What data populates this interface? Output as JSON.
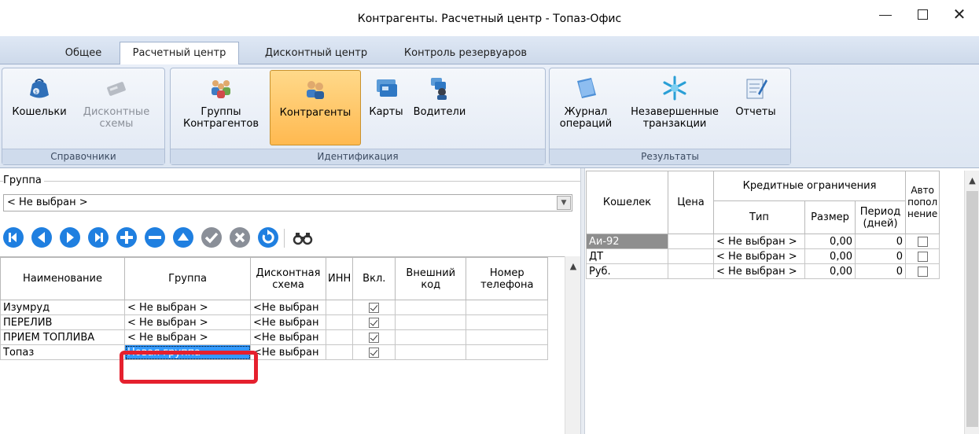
{
  "window": {
    "title": "Контрагенты. Расчетный центр - Топаз-Офис",
    "minimize": "–",
    "maximize": "☐",
    "close": "✕"
  },
  "tabs": [
    {
      "label": "Общее",
      "active": false
    },
    {
      "label": "Расчетный центр",
      "active": true
    },
    {
      "label": "Дисконтный центр",
      "active": false
    },
    {
      "label": "Контроль резервуаров",
      "active": false
    }
  ],
  "ribbon": {
    "groups": [
      {
        "label": "Справочники",
        "buttons": [
          {
            "label": "Кошельки",
            "icon": "wallet-bag-icon",
            "state": "normal"
          },
          {
            "label": "Дисконтные схемы",
            "icon": "discount-scheme-icon",
            "state": "disabled"
          }
        ]
      },
      {
        "label": "Идентификация",
        "buttons": [
          {
            "label": "Группы Контрагентов",
            "icon": "contractor-groups-icon",
            "state": "normal"
          },
          {
            "label": "Контрагенты",
            "icon": "contractors-icon",
            "state": "active"
          },
          {
            "label": "Карты",
            "icon": "cards-icon",
            "state": "normal"
          },
          {
            "label": "Водители",
            "icon": "drivers-icon",
            "state": "normal"
          }
        ]
      },
      {
        "label": "Результаты",
        "buttons": [
          {
            "label": "Журнал операций",
            "icon": "operations-journal-icon",
            "state": "normal"
          },
          {
            "label": "Незавершенные транзакции",
            "icon": "unfinished-transactions-icon",
            "state": "normal"
          },
          {
            "label": "Отчеты",
            "icon": "reports-icon",
            "state": "normal"
          }
        ]
      }
    ]
  },
  "group_filter": {
    "legend": "Группа",
    "value": "< Не выбран >"
  },
  "navigator": [
    "first-icon",
    "prev-icon",
    "next-icon",
    "last-icon",
    "add-icon",
    "delete-icon",
    "up-icon",
    "confirm-icon",
    "cancel-icon",
    "refresh-icon",
    "binoculars-icon"
  ],
  "contractors_table": {
    "headers": [
      "Наименование",
      "Группа",
      "Дисконтная схема",
      "ИНН",
      "Вкл.",
      "Внешний код",
      "Номер телефона"
    ],
    "rows": [
      {
        "name": "Изумруд",
        "group": "< Не выбран >",
        "scheme": "<Не выбран",
        "inn": "",
        "enabled": true,
        "ext": "",
        "phone": ""
      },
      {
        "name": "ПЕРЕЛИВ",
        "group": "< Не выбран >",
        "scheme": "<Не выбран",
        "inn": "",
        "enabled": true,
        "ext": "",
        "phone": ""
      },
      {
        "name": "ПРИЕМ ТОПЛИВА",
        "group": "< Не выбран >",
        "scheme": "<Не выбран",
        "inn": "",
        "enabled": true,
        "ext": "",
        "phone": ""
      },
      {
        "name": "Топаз",
        "group": "Новая группа",
        "scheme": "<Не выбран",
        "inn": "",
        "enabled": true,
        "ext": "",
        "phone": ""
      }
    ]
  },
  "wallets_table": {
    "headers": {
      "wallet": "Кошелек",
      "price": "Цена",
      "credit": "Кредитные ограничения",
      "type": "Тип",
      "size": "Размер",
      "period": "Период (дней)",
      "auto": "Авто попол нение"
    },
    "rows": [
      {
        "wallet": "Аи-92",
        "price": "",
        "type": "< Не выбран >",
        "size": "0,00",
        "period": "0",
        "auto": false
      },
      {
        "wallet": "ДТ",
        "price": "",
        "type": "< Не выбран >",
        "size": "0,00",
        "period": "0",
        "auto": false
      },
      {
        "wallet": "Руб.",
        "price": "",
        "type": "< Не выбран >",
        "size": "0,00",
        "period": "0",
        "auto": false
      }
    ]
  },
  "colors": {
    "accent": "#ffb950",
    "selection": "#3399ff",
    "highlight_box": "#e5202e"
  }
}
